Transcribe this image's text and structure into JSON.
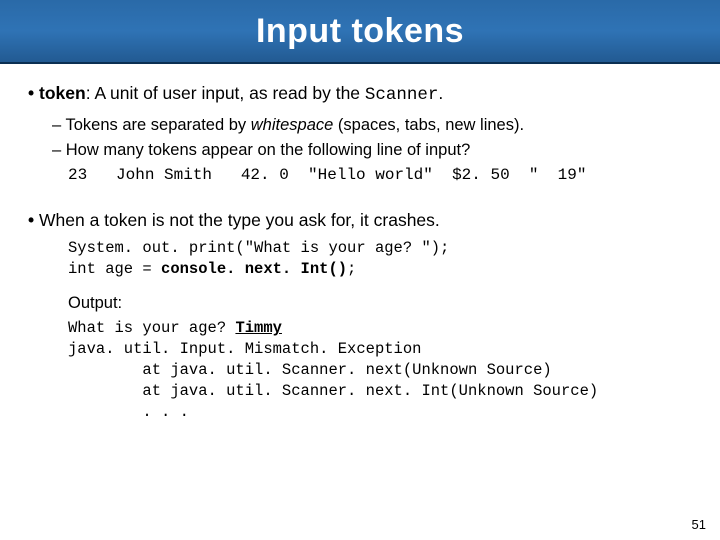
{
  "title": "Input tokens",
  "bullet1": {
    "term": "token",
    "sep": ": ",
    "rest1": "A unit of user input, as read by the ",
    "scanner": "Scanner",
    "period": "."
  },
  "sub1": {
    "a_pre": "Tokens are separated by ",
    "a_em": "whitespace",
    "a_post": " (spaces, tabs, new lines).",
    "b": "How many tokens appear on the following line of input?"
  },
  "codeline": "23   John Smith   42. 0  \"Hello world\"  $2. 50  \"  19\"",
  "bullet2": "When a token is not the type you ask for, it crashes.",
  "code2_l1_a": "System. out. print(\"What is your age? \");",
  "code2_l2_a": "int age = ",
  "code2_l2_b": "console. next. Int()",
  "code2_l2_c": ";",
  "output_label": "Output:",
  "out_l1_a": "What is your age? ",
  "out_l1_b": "Timmy",
  "out_l2": "java. util. Input. Mismatch. Exception",
  "out_l3": "        at java. util. Scanner. next(Unknown Source)",
  "out_l4": "        at java. util. Scanner. next. Int(Unknown Source)",
  "out_l5": "        . . .",
  "page": "51"
}
